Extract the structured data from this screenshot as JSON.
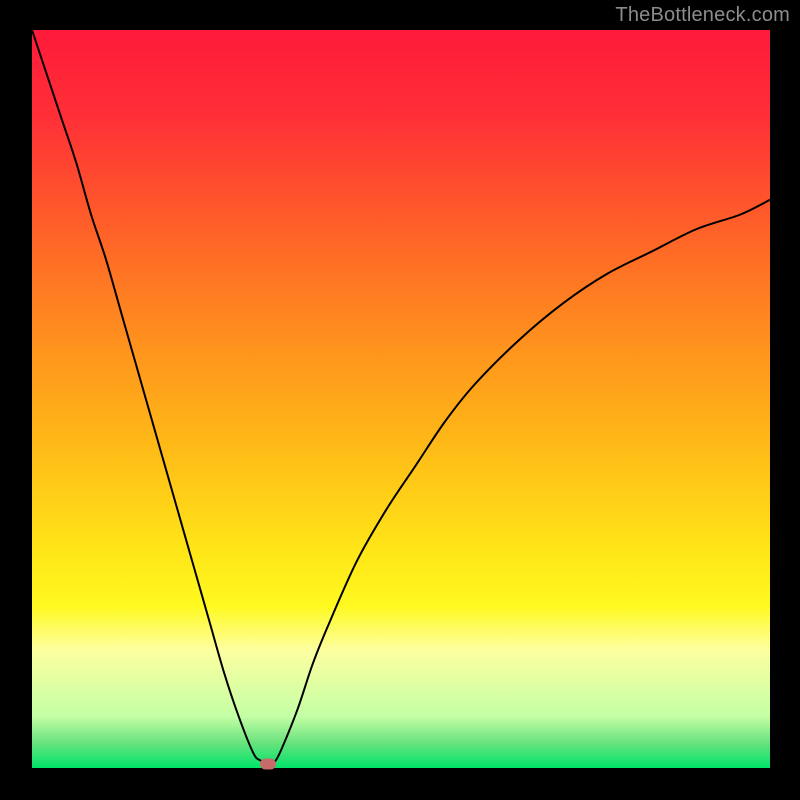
{
  "watermark": "TheBottleneck.com",
  "chart_data": {
    "type": "line",
    "title": "",
    "xlabel": "",
    "ylabel": "",
    "xlim": [
      0,
      100
    ],
    "ylim": [
      0,
      100
    ],
    "grid": false,
    "legend": false,
    "background_gradient": {
      "stops": [
        {
          "pos": 0.0,
          "color": "#ff1a3a"
        },
        {
          "pos": 0.12,
          "color": "#ff3037"
        },
        {
          "pos": 0.25,
          "color": "#ff5a2a"
        },
        {
          "pos": 0.4,
          "color": "#ff8a1f"
        },
        {
          "pos": 0.55,
          "color": "#ffb617"
        },
        {
          "pos": 0.7,
          "color": "#ffe417"
        },
        {
          "pos": 0.78,
          "color": "#fff91f"
        },
        {
          "pos": 0.84,
          "color": "#fdffa0"
        },
        {
          "pos": 0.93,
          "color": "#c4ffa5"
        },
        {
          "pos": 0.965,
          "color": "#6be37e"
        },
        {
          "pos": 1.0,
          "color": "#00e36a"
        }
      ]
    },
    "series": [
      {
        "name": "bottleneck-curve",
        "color": "#000000",
        "stroke_width": 2,
        "x": [
          0,
          2,
          4,
          6,
          8,
          10,
          12,
          14,
          16,
          18,
          20,
          22,
          24,
          26,
          28,
          30,
          31,
          32,
          33,
          34,
          36,
          38,
          40,
          44,
          48,
          52,
          56,
          60,
          66,
          72,
          78,
          84,
          90,
          96,
          100
        ],
        "y": [
          100,
          94,
          88,
          82,
          75,
          69,
          62,
          55,
          48,
          41,
          34,
          27,
          20,
          13,
          7,
          2,
          1,
          0.5,
          1,
          3,
          8,
          14,
          19,
          28,
          35,
          41,
          47,
          52,
          58,
          63,
          67,
          70,
          73,
          75,
          77
        ]
      }
    ],
    "marker": {
      "name": "optimum-point",
      "x": 32,
      "y": 0.5,
      "color": "#c76a6a"
    }
  }
}
